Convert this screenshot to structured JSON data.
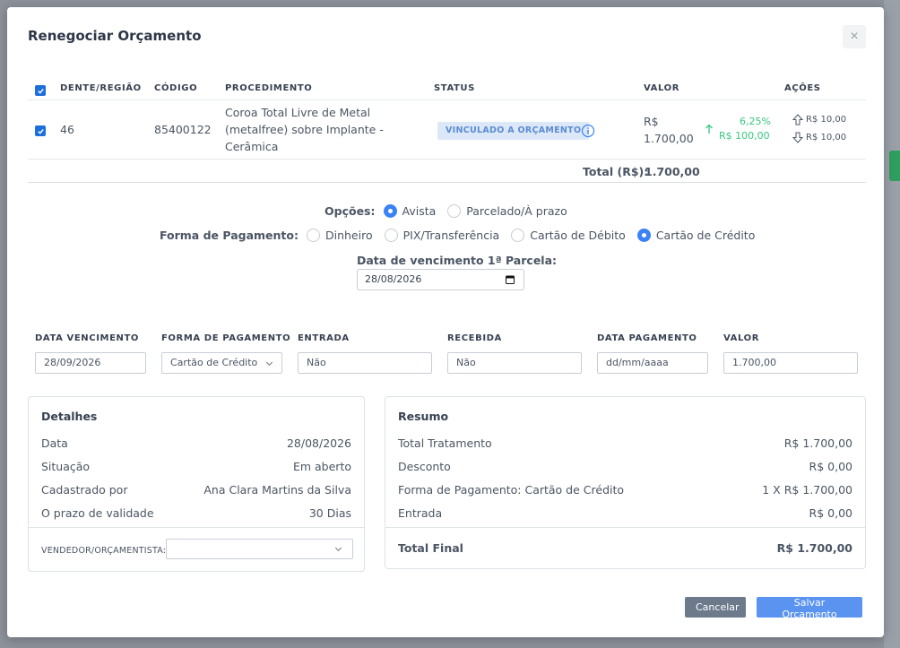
{
  "modal": {
    "title": "Renegociar Orçamento",
    "close_glyph": "×"
  },
  "table": {
    "headers": {
      "dente": "DENTE/REGIÃO",
      "codigo": "CÓDIGO",
      "procedimento": "PROCEDIMENTO",
      "status": "STATUS",
      "valor": "VALOR",
      "acoes": "AÇÕES"
    },
    "rows": [
      {
        "dente": "46",
        "codigo": "85400122",
        "procedimento_l1": "Coroa Total Livre de Metal",
        "procedimento_l2": "(metalfree) sobre Implante -",
        "procedimento_l3": "Cerâmica",
        "status": "VINCULADO A ORÇAMENTO",
        "valor_l1": "R$",
        "valor_l2": "1.700,00",
        "percent": "6,25%",
        "diff": "R$ 100,00",
        "acao_up": "R$ 10,00",
        "acao_down": "R$ 10,00",
        "checked": true
      }
    ],
    "total_label": "Total (R$):",
    "total_value": "1.700,00"
  },
  "opcoes": {
    "label": "Opções:",
    "options": [
      "Avista",
      "Parcelado/À prazo"
    ],
    "selected": "Avista"
  },
  "forma_pagamento": {
    "label": "Forma de Pagamento:",
    "options": [
      "Dinheiro",
      "PIX/Transferência",
      "Cartão de Débito",
      "Cartão de Crédito"
    ],
    "selected": "Cartão de Crédito"
  },
  "vencimento": {
    "label": "Data de vencimento 1ª Parcela:",
    "value": "28/08/2026"
  },
  "parcelas": {
    "headers": {
      "data_vencimento": "DATA VENCIMENTO",
      "forma_pagamento": "FORMA DE PAGAMENTO",
      "entrada": "ENTRADA",
      "recebida": "RECEBIDA",
      "data_pagamento": "DATA PAGAMENTO",
      "valor": "VALOR"
    },
    "row": {
      "data_vencimento": "28/09/2026",
      "forma_pagamento": "Cartão de Crédito",
      "entrada": "Não",
      "recebida": "Não",
      "data_pagamento_placeholder": "dd/mm/aaaa",
      "valor": "1.700,00"
    }
  },
  "detalhes": {
    "title": "Detalhes",
    "items": [
      {
        "k": "Data",
        "v": "28/08/2026"
      },
      {
        "k": "Situação",
        "v": "Em aberto"
      },
      {
        "k": "Cadastrado por",
        "v": "Ana Clara Martins da Silva"
      },
      {
        "k": "O prazo de validade",
        "v": "30 Dias"
      }
    ],
    "vendedor_label": "VENDEDOR/ORÇAMENTISTA:"
  },
  "resumo": {
    "title": "Resumo",
    "items": [
      {
        "k": "Total Tratamento",
        "v": "R$ 1.700,00"
      },
      {
        "k": "Desconto",
        "v": "R$ 0,00"
      },
      {
        "k": "Forma de Pagamento: Cartão de Crédito",
        "v": "1 X R$ 1.700,00"
      },
      {
        "k": "Entrada",
        "v": "R$ 0,00"
      }
    ],
    "total_final_label": "Total Final",
    "total_final_value": "R$ 1.700,00"
  },
  "footer": {
    "cancel_label": "Cancelar",
    "save_label": "Salvar Orçamento"
  },
  "colors": {
    "accent": "#3b82f6",
    "check": "#1d6fdc",
    "positive": "#3bc77d",
    "badge_bg": "#dce8f8"
  },
  "icons": [
    "close-icon",
    "check-icon",
    "info-icon",
    "arrow-up-icon",
    "arrow-down-icon",
    "calendar-icon",
    "chevron-down-icon"
  ]
}
